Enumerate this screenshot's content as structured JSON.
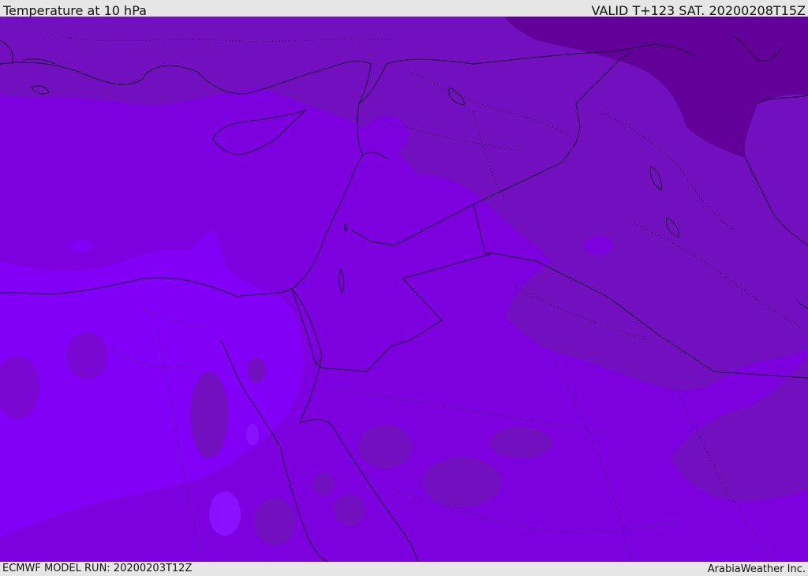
{
  "header": {
    "title": "Temperature at 10 hPa",
    "valid": "VALID T+123 SAT. 20200208T15Z"
  },
  "footer": {
    "model_run": "ECMWF MODEL RUN: 20200203T12Z",
    "credit": "ArabiaWeather Inc."
  },
  "map": {
    "field_colors": {
      "base": "#7d00de",
      "warm_band": "#8300f6",
      "cool_patch": "#7210bf",
      "coldest_patch": "#64009a"
    },
    "line_color": "#1a0030"
  }
}
